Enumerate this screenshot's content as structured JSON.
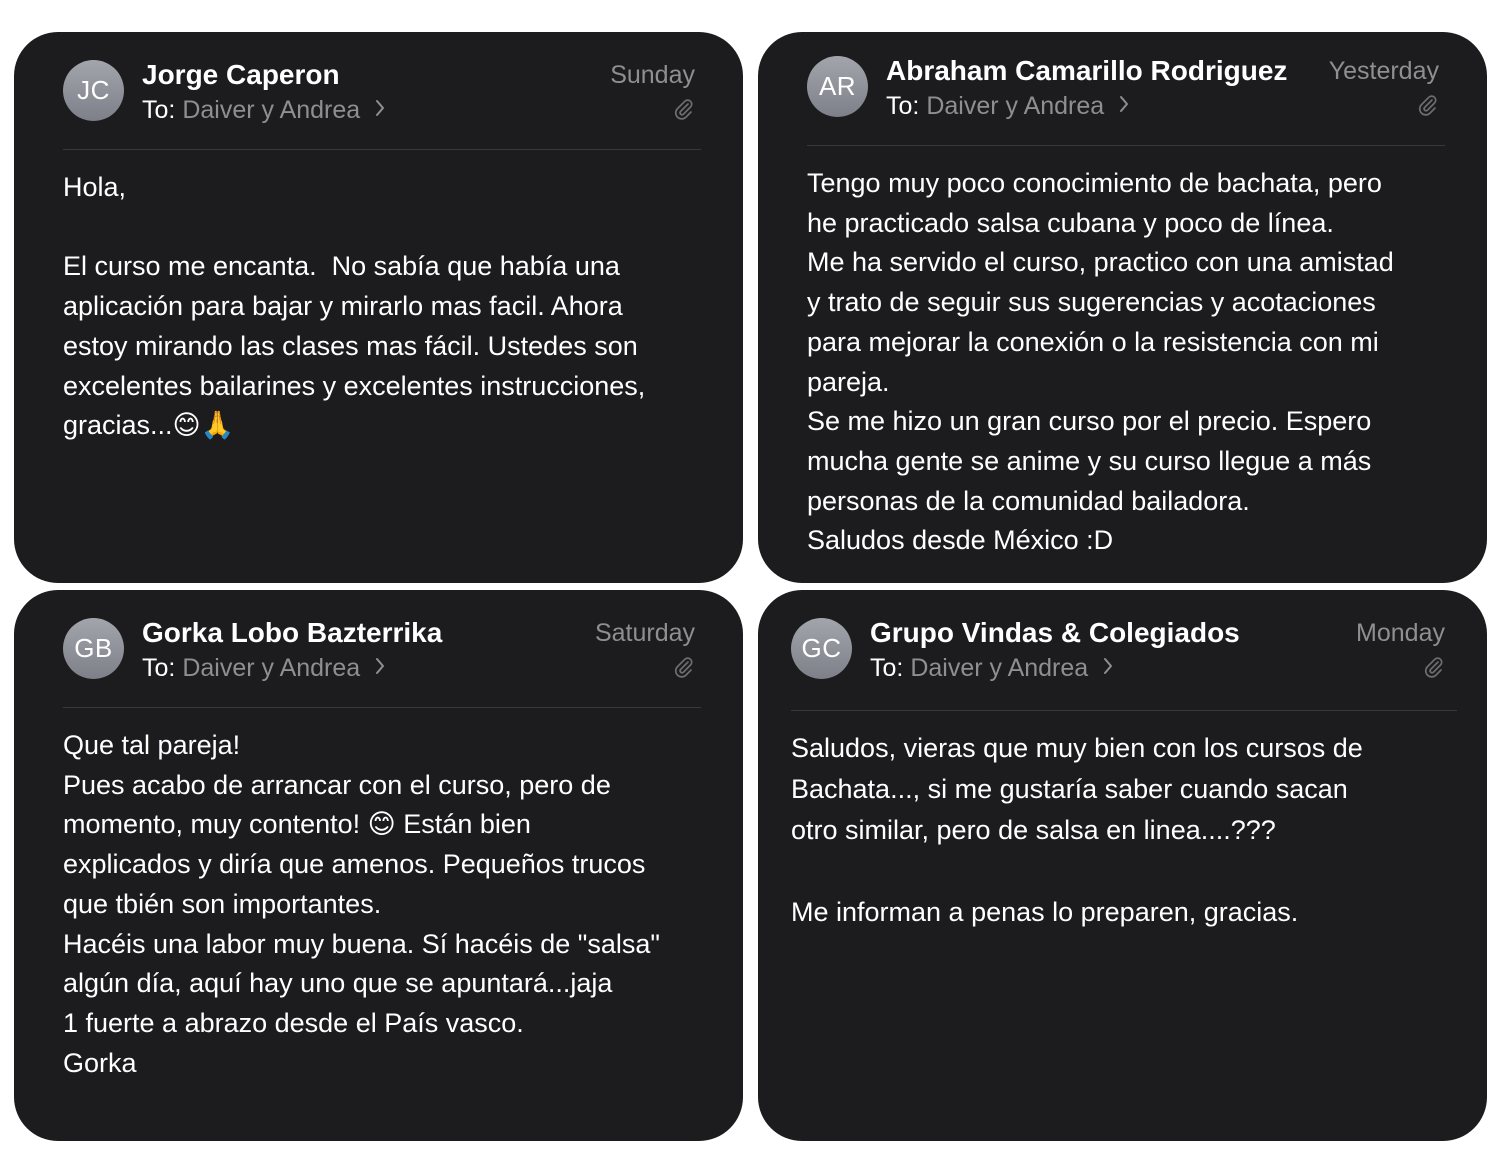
{
  "colors": {
    "card_background": "#1c1c1e",
    "page_background": "#ffffff",
    "secondary_text": "#8e8e93",
    "divider": "#38383a",
    "avatar_gradient_top": "#a3a5ad",
    "avatar_gradient_bottom": "#7e8089"
  },
  "emails": [
    {
      "initials": "JC",
      "sender": "Jorge Caperon",
      "to_label": "To:",
      "recipients": "Daiver y Andrea",
      "date": "Sunday",
      "attachment_icon": "paperclip-icon",
      "body": [
        "Hola,",
        "",
        "El curso me encanta.  No sabía que había una",
        "aplicación para bajar y mirarlo mas facil. Ahora",
        "estoy mirando las clases mas fácil. Ustedes son",
        "excelentes bailarines y excelentes instrucciones,",
        "gracias...😊🙏"
      ]
    },
    {
      "initials": "AR",
      "sender": "Abraham Camarillo Rodriguez",
      "to_label": "To:",
      "recipients": "Daiver y Andrea",
      "date": "Yesterday",
      "attachment_icon": "paperclip-icon",
      "body": [
        "Tengo muy poco conocimiento de bachata, pero",
        "he practicado salsa cubana y poco de línea.",
        "Me ha servido el curso, practico con una amistad",
        "y trato de seguir sus sugerencias y acotaciones",
        "para mejorar la conexión o la resistencia con mi",
        "pareja.",
        "Se me hizo un gran curso por el precio. Espero",
        "mucha gente se anime y su curso llegue a más",
        "personas de la comunidad bailadora.",
        "Saludos desde México :D"
      ]
    },
    {
      "initials": "GB",
      "sender": "Gorka Lobo Bazterrika",
      "to_label": "To:",
      "recipients": "Daiver y Andrea",
      "date": "Saturday",
      "attachment_icon": "paperclip-icon",
      "body": [
        "Que tal pareja!",
        "Pues acabo de arrancar con el curso, pero de",
        "momento, muy contento! 😊 Están bien",
        "explicados y diría que amenos. Pequeños trucos",
        "que tbién son importantes.",
        "Hacéis una labor muy buena. Sí hacéis de \"salsa\"",
        "algún día, aquí hay uno que se apuntará...jaja",
        "1 fuerte a abrazo desde el País vasco.",
        "Gorka"
      ]
    },
    {
      "initials": "GC",
      "sender": "Grupo Vindas & Colegiados",
      "to_label": "To:",
      "recipients": "Daiver y Andrea",
      "date": "Monday",
      "attachment_icon": "paperclip-icon",
      "body": [
        "Saludos, vieras que muy bien con los cursos de",
        "Bachata..., si me gustaría saber cuando sacan",
        "otro similar, pero de salsa en linea....???",
        "",
        "Me informan a penas lo preparen, gracias."
      ]
    }
  ]
}
